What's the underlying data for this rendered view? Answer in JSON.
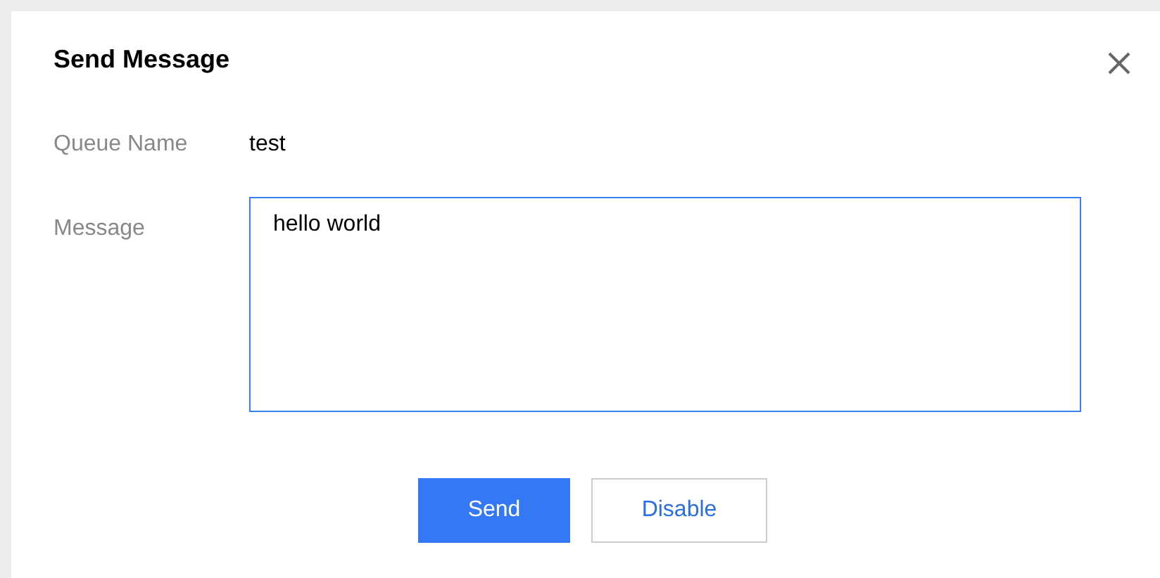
{
  "dialog": {
    "title": "Send Message",
    "fields": [
      {
        "label": "Queue Name",
        "kind": "text",
        "value": "test"
      },
      {
        "label": "Message",
        "kind": "textarea",
        "value": "hello world"
      }
    ],
    "buttons": [
      {
        "label": "Send",
        "kind": "primary"
      },
      {
        "label": "Disable",
        "kind": "secondary"
      }
    ]
  }
}
